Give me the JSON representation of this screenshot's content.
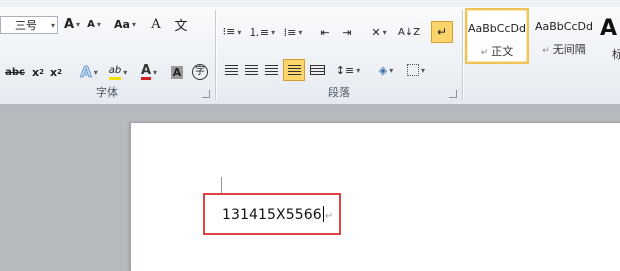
{
  "ribbon": {
    "top_fragments": [
      "体",
      "段落"
    ],
    "font": {
      "group_label": "字体",
      "font_size": "三号",
      "grow_font": "A",
      "shrink_font": "A",
      "change_case": "Aa",
      "clear_format": "A",
      "phonetic": "文",
      "enclose": "字",
      "strikethrough": "abc",
      "subscript": "x",
      "superscript": "x",
      "text_effect": "A",
      "highlight": "ab",
      "font_color": "A",
      "char_shading": "A",
      "enclose_char": "字"
    },
    "paragraph": {
      "group_label": "段落"
    },
    "styles": {
      "items": [
        {
          "sample": "AaBbCcDd",
          "name": "正文"
        },
        {
          "sample": "AaBbCcDd",
          "name": "无间隔"
        }
      ],
      "big_sample": "A",
      "cut_label": "标"
    }
  },
  "document": {
    "text": "131415X5566",
    "paragraph_mark": "↵"
  },
  "colors": {
    "highlight_box": "#e04343",
    "font_color_bar": "#d32020",
    "highlight_bar": "#f2e400",
    "active_style_border": "#f1c15a"
  }
}
